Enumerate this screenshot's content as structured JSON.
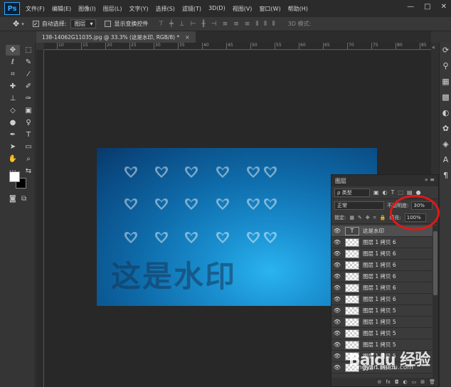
{
  "app": {
    "logo": "Ps",
    "menu": [
      "文件(F)",
      "编辑(E)",
      "图像(I)",
      "图层(L)",
      "文字(Y)",
      "选择(S)",
      "滤镜(T)",
      "3D(D)",
      "视图(V)",
      "窗口(W)",
      "帮助(H)"
    ],
    "window_controls": [
      "—",
      "□",
      "✕"
    ]
  },
  "options_bar": {
    "auto_select_label": "自动选择:",
    "auto_select_target": "图层",
    "show_transform_label": "显示变换控件",
    "mode_3d_label": "3D 模式:"
  },
  "document": {
    "tab_title": "138-14062G11035.jpg @ 33.3% (这是水印, RGB/8) *",
    "close_symbol": "×"
  },
  "ruler_ticks": [
    "10",
    "15",
    "20",
    "25",
    "30",
    "35",
    "40",
    "45",
    "50",
    "55",
    "60",
    "65",
    "70",
    "75",
    "80",
    "85"
  ],
  "image": {
    "watermark_text": "这是水印"
  },
  "layers_panel": {
    "title": "图层",
    "filter_kind": "ρ 类型",
    "blend_mode": "正常",
    "opacity_label": "不透明度:",
    "opacity_value": "30%",
    "lock_label": "锁定:",
    "fill_label": "填充:",
    "fill_value": "100%",
    "layers": [
      {
        "name": "这是水印",
        "type": "text",
        "selected": true
      },
      {
        "name": "图层 1 拷贝 6",
        "type": "pixel"
      },
      {
        "name": "图层 1 拷贝 6",
        "type": "pixel"
      },
      {
        "name": "图层 1 拷贝 6",
        "type": "pixel"
      },
      {
        "name": "图层 1 拷贝 6",
        "type": "pixel"
      },
      {
        "name": "图层 1 拷贝 6",
        "type": "pixel"
      },
      {
        "name": "图层 1 拷贝 6",
        "type": "pixel"
      },
      {
        "name": "图层 1 拷贝 5",
        "type": "pixel"
      },
      {
        "name": "图层 1 拷贝 5",
        "type": "pixel"
      },
      {
        "name": "图层 1 拷贝 5",
        "type": "pixel"
      },
      {
        "name": "图层 1 拷贝 5",
        "type": "pixel"
      },
      {
        "name": "图层 1 拷贝 5",
        "type": "pixel"
      },
      {
        "name": "图层 1 拷贝 5",
        "type": "pixel"
      }
    ],
    "footer_icons": [
      "link-icon",
      "fx-icon",
      "mask-icon",
      "adjustment-icon",
      "group-icon",
      "new-layer-icon",
      "trash-icon"
    ]
  },
  "watermark_site": {
    "brand": "Baidu 经验",
    "url": "jingyan.baidu.com"
  },
  "colors": {
    "accent": "#31a8ff",
    "annotation": "#e01818",
    "image_blue": "#1a8fd0"
  }
}
